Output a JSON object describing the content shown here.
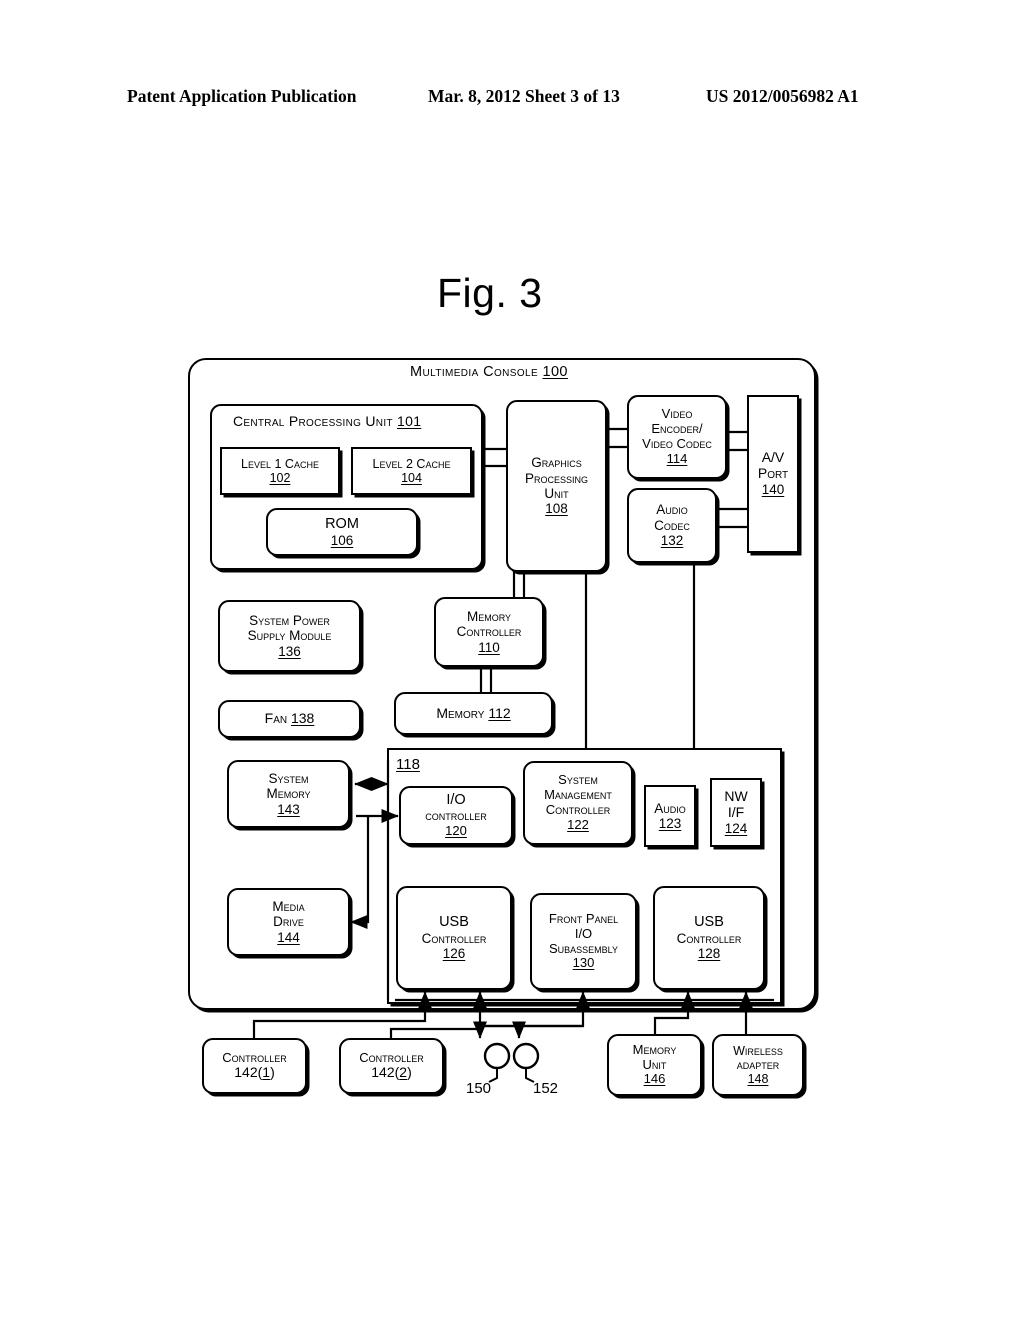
{
  "header": {
    "publication": "Patent Application Publication",
    "date_sheet": "Mar. 8, 2012   Sheet 3 of 13",
    "patent_number": "US 2012/0056982 A1"
  },
  "figure": {
    "title": "Fig. 3",
    "console_title": "Multimedia Console",
    "console_ref": "100",
    "bus_ref": "118",
    "node_150": "150",
    "node_152": "152"
  },
  "blocks": {
    "cpu": {
      "line1": "Central Processing Unit",
      "ref": "101"
    },
    "l1cache": {
      "line1": "Level 1 Cache",
      "ref": "102"
    },
    "l2cache": {
      "line1": "Level 2 Cache",
      "ref": "104"
    },
    "rom": {
      "line1": "ROM",
      "ref": "106"
    },
    "gpu": {
      "line1": "Graphics",
      "line2": "Processing",
      "line3": "Unit",
      "ref": "108"
    },
    "video_codec": {
      "line1": "Video",
      "line2": "Encoder/",
      "line3": "Video Codec",
      "ref": "114"
    },
    "audio_codec": {
      "line1": "Audio",
      "line2": "Codec",
      "ref": "132"
    },
    "av_port": {
      "line1": "A/V",
      "line2": "Port",
      "ref": "140"
    },
    "psu": {
      "line1": "System Power",
      "line2": "Supply Module",
      "ref": "136"
    },
    "fan": {
      "line1": "Fan",
      "ref": "138"
    },
    "mem_ctrl": {
      "line1": "Memory",
      "line2": "Controller",
      "ref": "110"
    },
    "memory": {
      "line1": "Memory",
      "ref": "112"
    },
    "sys_memory": {
      "line1": "System",
      "line2": "Memory",
      "ref": "143"
    },
    "media_drive": {
      "line1": "Media",
      "line2": "Drive",
      "ref": "144"
    },
    "io_ctrl": {
      "line1": "I/O",
      "line2": "controller",
      "ref": "120"
    },
    "sys_mgmt": {
      "line1": "System",
      "line2": "Management",
      "line3": "Controller",
      "ref": "122"
    },
    "audio": {
      "line1": "Audio",
      "ref": "123"
    },
    "nw_if": {
      "line1": "NW",
      "line2": "I/F",
      "ref": "124"
    },
    "usb_ctrl_1": {
      "line1": "USB",
      "line2": "Controller",
      "ref": "126"
    },
    "front_panel": {
      "line1": "Front Panel",
      "line2": "I/O",
      "line3": "Subassembly",
      "ref": "130"
    },
    "usb_ctrl_2": {
      "line1": "USB",
      "line2": "Controller",
      "ref": "128"
    },
    "controller1": {
      "line1": "Controller",
      "ref": "142(1)"
    },
    "controller2": {
      "line1": "Controller",
      "ref": "142(2)"
    },
    "memory_unit": {
      "line1": "Memory",
      "line2": "Unit",
      "ref": "146"
    },
    "wireless": {
      "line1": "Wireless",
      "line2": "adapter",
      "ref": "148"
    }
  }
}
